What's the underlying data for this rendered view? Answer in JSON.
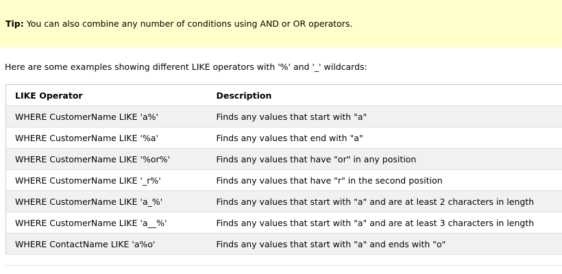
{
  "tip": {
    "label": "Tip:",
    "text": "You can also combine any number of conditions using AND or OR operators."
  },
  "intro": "Here are some examples showing different LIKE operators with '%' and '_' wildcards:",
  "table": {
    "headers": [
      "LIKE Operator",
      "Description"
    ],
    "rows": [
      [
        "WHERE CustomerName LIKE 'a%'",
        "Finds any values that start with \"a\""
      ],
      [
        "WHERE CustomerName LIKE '%a'",
        "Finds any values that end with \"a\""
      ],
      [
        "WHERE CustomerName LIKE '%or%'",
        "Finds any values that have \"or\" in any position"
      ],
      [
        "WHERE CustomerName LIKE '_r%'",
        "Finds any values that have \"r\" in the second position"
      ],
      [
        "WHERE CustomerName LIKE 'a_%'",
        "Finds any values that start with \"a\" and are at least 2 characters in length"
      ],
      [
        "WHERE CustomerName LIKE 'a__%'",
        "Finds any values that start with \"a\" and are at least 3 characters in length"
      ],
      [
        "WHERE ContactName LIKE 'a%o'",
        "Finds any values that start with \"a\" and ends with \"o\""
      ]
    ]
  },
  "colors": {
    "tip_background": "#ffffcc",
    "row_stripe": "#f1f1f1",
    "border": "#cccccc"
  }
}
